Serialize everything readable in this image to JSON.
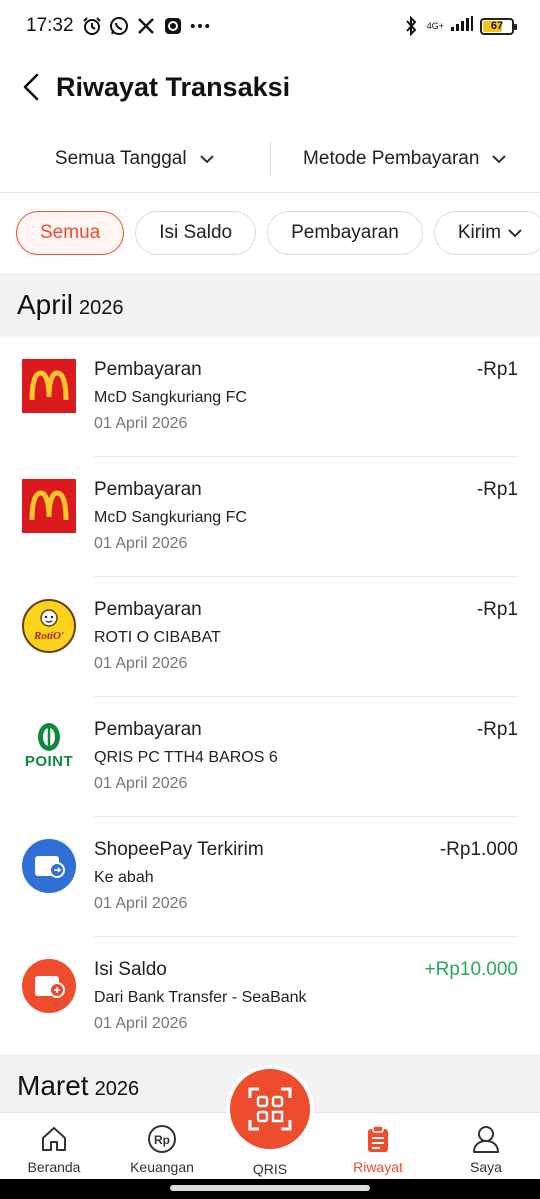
{
  "status_bar": {
    "time": "17:32",
    "network": "4G+",
    "battery": "67",
    "icons": [
      "alarm-icon",
      "whatsapp-icon",
      "x-icon",
      "app-icon",
      "more-dots-icon",
      "bluetooth-icon",
      "signal-icon",
      "battery-icon"
    ]
  },
  "header": {
    "title": "Riwayat Transaksi"
  },
  "filters": {
    "date": "Semua Tanggal",
    "method": "Metode Pembayaran"
  },
  "chips": [
    {
      "label": "Semua",
      "active": true
    },
    {
      "label": "Isi Saldo",
      "active": false
    },
    {
      "label": "Pembayaran",
      "active": false
    },
    {
      "label": "Kirim",
      "active": false
    }
  ],
  "months": [
    {
      "name": "April",
      "year": "2026"
    },
    {
      "name": "Maret",
      "year": "2026"
    }
  ],
  "transactions": [
    {
      "title": "Pembayaran",
      "merchant": "McD Sangkuriang FC",
      "date": "01 April 2026",
      "amount": "-Rp1",
      "logo": "mcdonalds-logo"
    },
    {
      "title": "Pembayaran",
      "merchant": "McD Sangkuriang FC",
      "date": "01 April 2026",
      "amount": "-Rp1",
      "logo": "mcdonalds-logo"
    },
    {
      "title": "Pembayaran",
      "merchant": "ROTI O CIBABAT",
      "date": "01 April 2026",
      "amount": "-Rp1",
      "logo": "rotio-logo",
      "logo_text": "RotiO'"
    },
    {
      "title": "Pembayaran",
      "merchant": "QRIS PC TTH4 BAROS 6",
      "date": "01 April 2026",
      "amount": "-Rp1",
      "logo": "point-coffee-logo",
      "logo_text": "POINT"
    },
    {
      "title": "ShopeePay Terkirim",
      "merchant": "Ke abah",
      "date": "01 April 2026",
      "amount": "-Rp1.000",
      "logo": "wallet-transfer-icon"
    },
    {
      "title": "Isi Saldo",
      "merchant": "Dari Bank Transfer - SeaBank",
      "date": "01 April 2026",
      "amount": "+Rp10.000",
      "logo": "wallet-topup-icon",
      "positive": true
    }
  ],
  "nav": {
    "items": [
      {
        "label": "Beranda",
        "icon": "home-icon"
      },
      {
        "label": "Keuangan",
        "icon": "rp-coin-icon"
      },
      {
        "label": "QRIS",
        "icon": "qr-scan-icon"
      },
      {
        "label": "Riwayat",
        "icon": "clipboard-icon",
        "active": true
      },
      {
        "label": "Saya",
        "icon": "user-icon"
      }
    ]
  },
  "colors": {
    "accent": "#ee4d2d",
    "positive": "#26aa5a",
    "mcd_red": "#da1a1f",
    "mcd_yellow": "#ffc72c",
    "wallet_blue": "#2f6fd6",
    "point_green": "#0f8a3c"
  }
}
